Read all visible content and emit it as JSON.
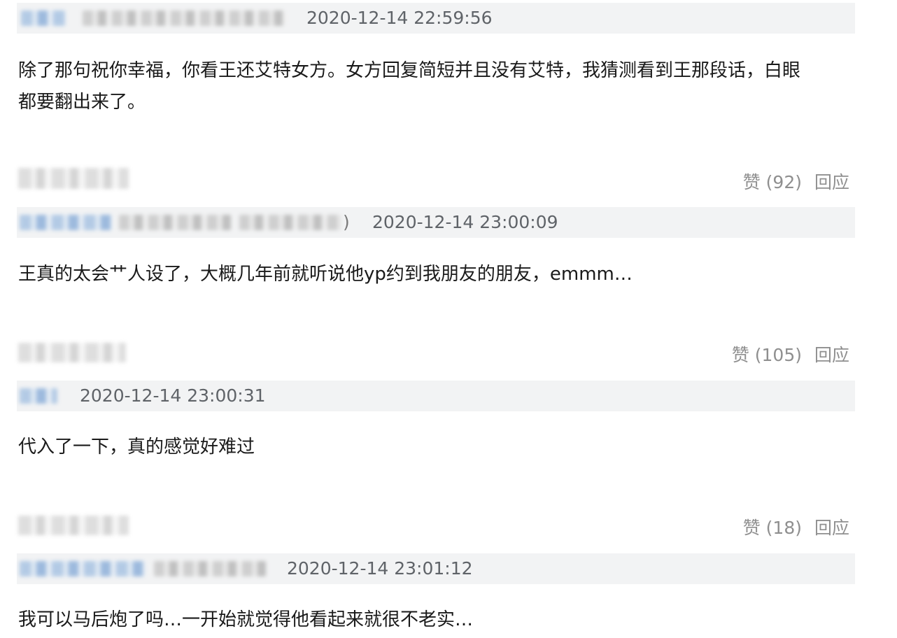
{
  "comments": [
    {
      "timestamp": "2020-12-14 22:59:56",
      "text": "除了那句祝你幸福，你看王还艾特女方。女方回复简短并且没有艾特，我猜测看到王那段话，白眼\n都要翻出来了。",
      "likes_label": "赞 (92)",
      "reply_label": "回应"
    },
    {
      "timestamp": "2020-12-14 23:00:09",
      "paren": ")",
      "text": "王真的太会艹人设了，大概几年前就听说他yp约到我朋友的朋友，emmm…",
      "likes_label": "赞 (105)",
      "reply_label": "回应"
    },
    {
      "timestamp": "2020-12-14 23:00:31",
      "text": "代入了一下，真的感觉好难过",
      "likes_label": "赞 (18)",
      "reply_label": "回应"
    },
    {
      "timestamp": "2020-12-14 23:01:12",
      "text": "我可以马后炮了吗…一开始就觉得他看起来就很不老实…"
    }
  ]
}
